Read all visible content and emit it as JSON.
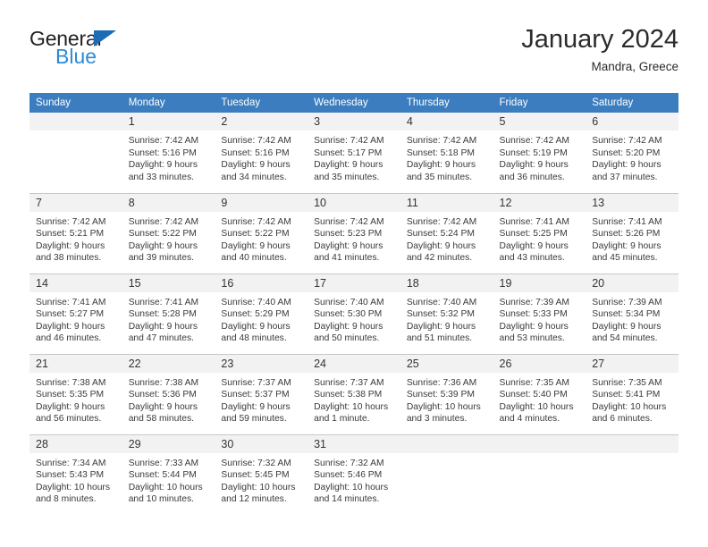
{
  "brand": {
    "name_primary": "General",
    "name_secondary": "Blue",
    "accent_color": "#2b8ad6",
    "triangle_color": "#1b6cb5"
  },
  "header": {
    "title": "January 2024",
    "location": "Mandra, Greece"
  },
  "calendar": {
    "header_background": "#3b7dbf",
    "daynum_background": "#f2f2f2",
    "weekday_headers": [
      "Sunday",
      "Monday",
      "Tuesday",
      "Wednesday",
      "Thursday",
      "Friday",
      "Saturday"
    ],
    "weeks": [
      [
        {
          "day": "",
          "empty": true,
          "sunrise": "",
          "sunset": "",
          "daylight_line1": "",
          "daylight_line2": ""
        },
        {
          "day": "1",
          "sunrise": "Sunrise: 7:42 AM",
          "sunset": "Sunset: 5:16 PM",
          "daylight_line1": "Daylight: 9 hours",
          "daylight_line2": "and 33 minutes."
        },
        {
          "day": "2",
          "sunrise": "Sunrise: 7:42 AM",
          "sunset": "Sunset: 5:16 PM",
          "daylight_line1": "Daylight: 9 hours",
          "daylight_line2": "and 34 minutes."
        },
        {
          "day": "3",
          "sunrise": "Sunrise: 7:42 AM",
          "sunset": "Sunset: 5:17 PM",
          "daylight_line1": "Daylight: 9 hours",
          "daylight_line2": "and 35 minutes."
        },
        {
          "day": "4",
          "sunrise": "Sunrise: 7:42 AM",
          "sunset": "Sunset: 5:18 PM",
          "daylight_line1": "Daylight: 9 hours",
          "daylight_line2": "and 35 minutes."
        },
        {
          "day": "5",
          "sunrise": "Sunrise: 7:42 AM",
          "sunset": "Sunset: 5:19 PM",
          "daylight_line1": "Daylight: 9 hours",
          "daylight_line2": "and 36 minutes."
        },
        {
          "day": "6",
          "sunrise": "Sunrise: 7:42 AM",
          "sunset": "Sunset: 5:20 PM",
          "daylight_line1": "Daylight: 9 hours",
          "daylight_line2": "and 37 minutes."
        }
      ],
      [
        {
          "day": "7",
          "sunrise": "Sunrise: 7:42 AM",
          "sunset": "Sunset: 5:21 PM",
          "daylight_line1": "Daylight: 9 hours",
          "daylight_line2": "and 38 minutes."
        },
        {
          "day": "8",
          "sunrise": "Sunrise: 7:42 AM",
          "sunset": "Sunset: 5:22 PM",
          "daylight_line1": "Daylight: 9 hours",
          "daylight_line2": "and 39 minutes."
        },
        {
          "day": "9",
          "sunrise": "Sunrise: 7:42 AM",
          "sunset": "Sunset: 5:22 PM",
          "daylight_line1": "Daylight: 9 hours",
          "daylight_line2": "and 40 minutes."
        },
        {
          "day": "10",
          "sunrise": "Sunrise: 7:42 AM",
          "sunset": "Sunset: 5:23 PM",
          "daylight_line1": "Daylight: 9 hours",
          "daylight_line2": "and 41 minutes."
        },
        {
          "day": "11",
          "sunrise": "Sunrise: 7:42 AM",
          "sunset": "Sunset: 5:24 PM",
          "daylight_line1": "Daylight: 9 hours",
          "daylight_line2": "and 42 minutes."
        },
        {
          "day": "12",
          "sunrise": "Sunrise: 7:41 AM",
          "sunset": "Sunset: 5:25 PM",
          "daylight_line1": "Daylight: 9 hours",
          "daylight_line2": "and 43 minutes."
        },
        {
          "day": "13",
          "sunrise": "Sunrise: 7:41 AM",
          "sunset": "Sunset: 5:26 PM",
          "daylight_line1": "Daylight: 9 hours",
          "daylight_line2": "and 45 minutes."
        }
      ],
      [
        {
          "day": "14",
          "sunrise": "Sunrise: 7:41 AM",
          "sunset": "Sunset: 5:27 PM",
          "daylight_line1": "Daylight: 9 hours",
          "daylight_line2": "and 46 minutes."
        },
        {
          "day": "15",
          "sunrise": "Sunrise: 7:41 AM",
          "sunset": "Sunset: 5:28 PM",
          "daylight_line1": "Daylight: 9 hours",
          "daylight_line2": "and 47 minutes."
        },
        {
          "day": "16",
          "sunrise": "Sunrise: 7:40 AM",
          "sunset": "Sunset: 5:29 PM",
          "daylight_line1": "Daylight: 9 hours",
          "daylight_line2": "and 48 minutes."
        },
        {
          "day": "17",
          "sunrise": "Sunrise: 7:40 AM",
          "sunset": "Sunset: 5:30 PM",
          "daylight_line1": "Daylight: 9 hours",
          "daylight_line2": "and 50 minutes."
        },
        {
          "day": "18",
          "sunrise": "Sunrise: 7:40 AM",
          "sunset": "Sunset: 5:32 PM",
          "daylight_line1": "Daylight: 9 hours",
          "daylight_line2": "and 51 minutes."
        },
        {
          "day": "19",
          "sunrise": "Sunrise: 7:39 AM",
          "sunset": "Sunset: 5:33 PM",
          "daylight_line1": "Daylight: 9 hours",
          "daylight_line2": "and 53 minutes."
        },
        {
          "day": "20",
          "sunrise": "Sunrise: 7:39 AM",
          "sunset": "Sunset: 5:34 PM",
          "daylight_line1": "Daylight: 9 hours",
          "daylight_line2": "and 54 minutes."
        }
      ],
      [
        {
          "day": "21",
          "sunrise": "Sunrise: 7:38 AM",
          "sunset": "Sunset: 5:35 PM",
          "daylight_line1": "Daylight: 9 hours",
          "daylight_line2": "and 56 minutes."
        },
        {
          "day": "22",
          "sunrise": "Sunrise: 7:38 AM",
          "sunset": "Sunset: 5:36 PM",
          "daylight_line1": "Daylight: 9 hours",
          "daylight_line2": "and 58 minutes."
        },
        {
          "day": "23",
          "sunrise": "Sunrise: 7:37 AM",
          "sunset": "Sunset: 5:37 PM",
          "daylight_line1": "Daylight: 9 hours",
          "daylight_line2": "and 59 minutes."
        },
        {
          "day": "24",
          "sunrise": "Sunrise: 7:37 AM",
          "sunset": "Sunset: 5:38 PM",
          "daylight_line1": "Daylight: 10 hours",
          "daylight_line2": "and 1 minute."
        },
        {
          "day": "25",
          "sunrise": "Sunrise: 7:36 AM",
          "sunset": "Sunset: 5:39 PM",
          "daylight_line1": "Daylight: 10 hours",
          "daylight_line2": "and 3 minutes."
        },
        {
          "day": "26",
          "sunrise": "Sunrise: 7:35 AM",
          "sunset": "Sunset: 5:40 PM",
          "daylight_line1": "Daylight: 10 hours",
          "daylight_line2": "and 4 minutes."
        },
        {
          "day": "27",
          "sunrise": "Sunrise: 7:35 AM",
          "sunset": "Sunset: 5:41 PM",
          "daylight_line1": "Daylight: 10 hours",
          "daylight_line2": "and 6 minutes."
        }
      ],
      [
        {
          "day": "28",
          "sunrise": "Sunrise: 7:34 AM",
          "sunset": "Sunset: 5:43 PM",
          "daylight_line1": "Daylight: 10 hours",
          "daylight_line2": "and 8 minutes."
        },
        {
          "day": "29",
          "sunrise": "Sunrise: 7:33 AM",
          "sunset": "Sunset: 5:44 PM",
          "daylight_line1": "Daylight: 10 hours",
          "daylight_line2": "and 10 minutes."
        },
        {
          "day": "30",
          "sunrise": "Sunrise: 7:32 AM",
          "sunset": "Sunset: 5:45 PM",
          "daylight_line1": "Daylight: 10 hours",
          "daylight_line2": "and 12 minutes."
        },
        {
          "day": "31",
          "sunrise": "Sunrise: 7:32 AM",
          "sunset": "Sunset: 5:46 PM",
          "daylight_line1": "Daylight: 10 hours",
          "daylight_line2": "and 14 minutes."
        },
        {
          "day": "",
          "empty": true,
          "sunrise": "",
          "sunset": "",
          "daylight_line1": "",
          "daylight_line2": ""
        },
        {
          "day": "",
          "empty": true,
          "sunrise": "",
          "sunset": "",
          "daylight_line1": "",
          "daylight_line2": ""
        },
        {
          "day": "",
          "empty": true,
          "sunrise": "",
          "sunset": "",
          "daylight_line1": "",
          "daylight_line2": ""
        }
      ]
    ]
  }
}
